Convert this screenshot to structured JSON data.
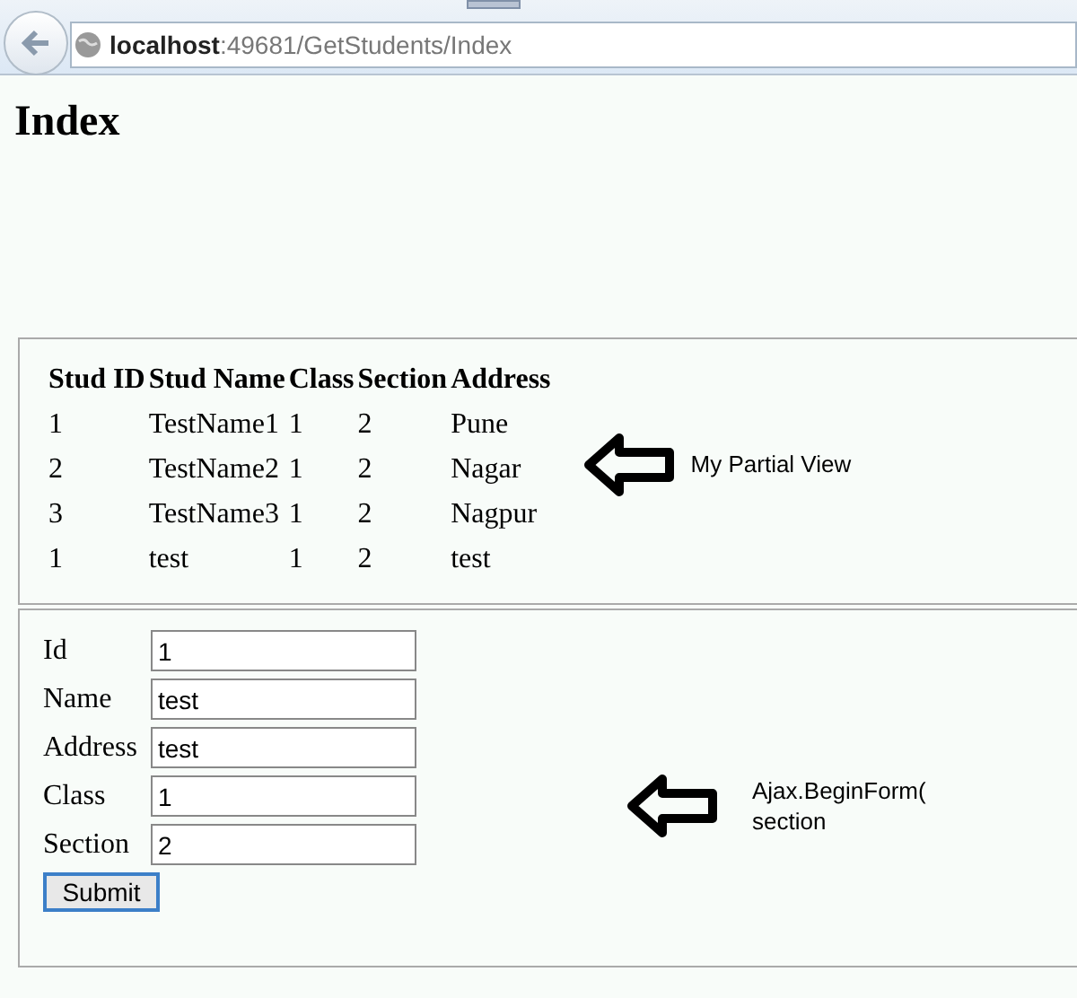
{
  "address_bar": {
    "host": "localhost",
    "path": ":49681/GetStudents/Index"
  },
  "heading": "Index",
  "partial_view": {
    "columns": [
      "Stud ID",
      "Stud Name",
      "Class",
      "Section",
      "Address"
    ],
    "rows": [
      [
        "1",
        "TestName1",
        "1",
        "2",
        "Pune"
      ],
      [
        "2",
        "TestName2",
        "1",
        "2",
        "Nagar"
      ],
      [
        "3",
        "TestName3",
        "1",
        "2",
        "Nagpur"
      ],
      [
        "1",
        "test",
        "1",
        "2",
        "test"
      ]
    ],
    "annotation": "My Partial View"
  },
  "form": {
    "fields": [
      {
        "label": "Id",
        "value": "1"
      },
      {
        "label": "Name",
        "value": "test"
      },
      {
        "label": "Address",
        "value": "test"
      },
      {
        "label": "Class",
        "value": "1"
      },
      {
        "label": "Section",
        "value": "2"
      }
    ],
    "submit": "Submit",
    "annotation": [
      "Ajax.BeginForm(",
      "section"
    ]
  }
}
